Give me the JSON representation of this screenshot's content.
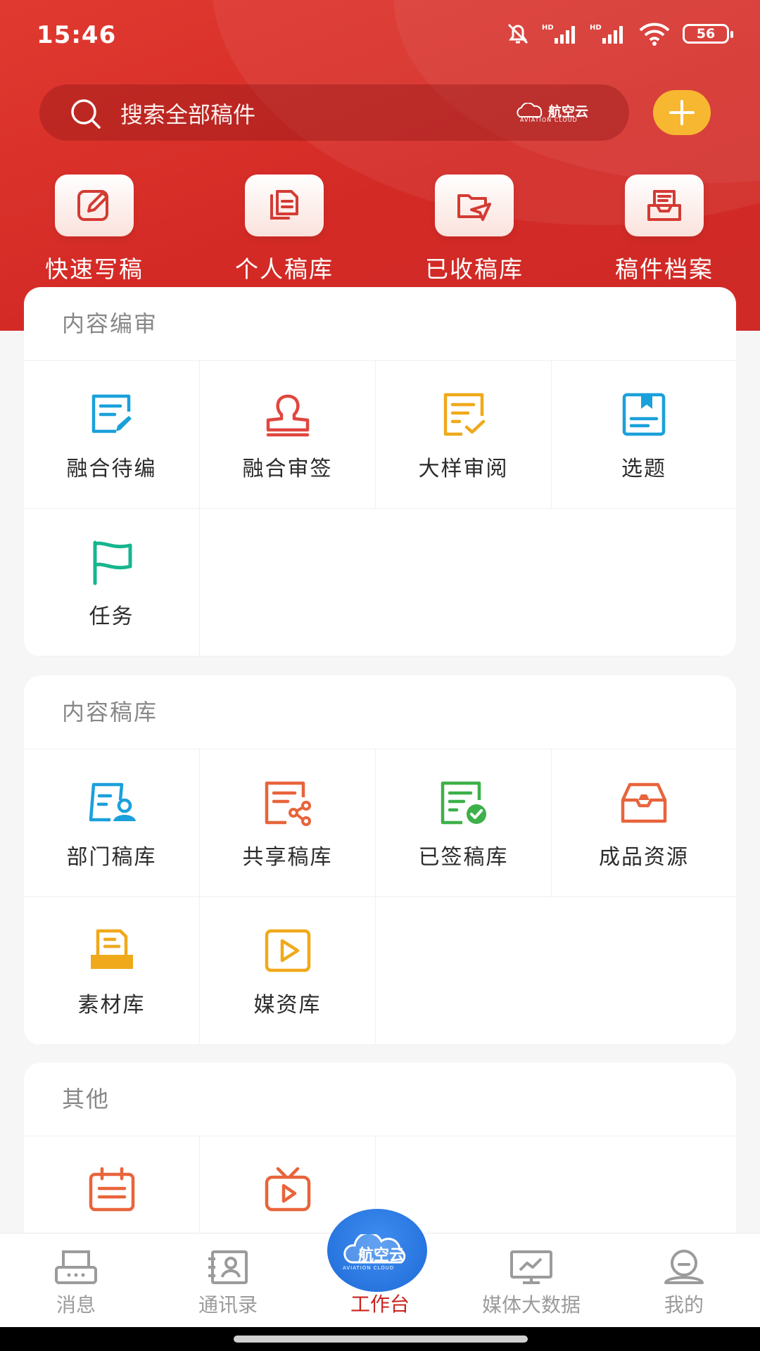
{
  "status": {
    "time": "15:46",
    "battery": "56",
    "signal_label": "HD"
  },
  "search": {
    "placeholder": "搜索全部稿件",
    "brand_cn": "航空云",
    "brand_en": "AVIATION CLOUD"
  },
  "quick_actions": [
    {
      "label": "快速写稿",
      "icon": "edit-icon"
    },
    {
      "label": "个人稿库",
      "icon": "documents-icon"
    },
    {
      "label": "已收稿库",
      "icon": "folder-send-icon"
    },
    {
      "label": "稿件档案",
      "icon": "archive-tray-icon"
    }
  ],
  "sections": [
    {
      "title": "内容编审",
      "items": [
        {
          "label": "融合待编",
          "icon": "edit-document-icon",
          "color": "#1aa0db"
        },
        {
          "label": "融合审签",
          "icon": "stamp-icon",
          "color": "#e0463f"
        },
        {
          "label": "大样审阅",
          "icon": "check-document-icon",
          "color": "#f0a91b"
        },
        {
          "label": "选题",
          "icon": "bookmark-book-icon",
          "color": "#1aa0db"
        },
        {
          "label": "任务",
          "icon": "flag-icon",
          "color": "#17b58d"
        }
      ]
    },
    {
      "title": "内容稿库",
      "items": [
        {
          "label": "部门稿库",
          "icon": "department-library-icon",
          "color": "#1aa0db"
        },
        {
          "label": "共享稿库",
          "icon": "share-document-icon",
          "color": "#e8643b"
        },
        {
          "label": "已签稿库",
          "icon": "signed-document-icon",
          "color": "#3db04a"
        },
        {
          "label": "成品资源",
          "icon": "product-box-icon",
          "color": "#e8643b"
        },
        {
          "label": "素材库",
          "icon": "material-library-icon",
          "color": "#f0a91b"
        },
        {
          "label": "媒资库",
          "icon": "media-play-icon",
          "color": "#f0a91b"
        }
      ]
    },
    {
      "title": "其他",
      "items": [
        {
          "label": "",
          "icon": "calendar-icon",
          "color": "#e8643b"
        },
        {
          "label": "",
          "icon": "tv-icon",
          "color": "#e8643b"
        }
      ]
    }
  ],
  "tabs": [
    {
      "label": "消息",
      "icon": "message-printer-icon"
    },
    {
      "label": "通讯录",
      "icon": "contacts-icon"
    },
    {
      "label": "工作台",
      "icon": "aviation-cloud-logo",
      "active": true,
      "logo_cn": "航空云",
      "logo_en": "AVIATION CLOUD"
    },
    {
      "label": "媒体大数据",
      "icon": "monitor-chart-icon"
    },
    {
      "label": "我的",
      "icon": "profile-icon"
    }
  ],
  "colors": {
    "brand_red": "#d42a26",
    "accent_yellow": "#f7b731",
    "active_tab": "#c8241f",
    "center_blue": "#2a78e4"
  }
}
